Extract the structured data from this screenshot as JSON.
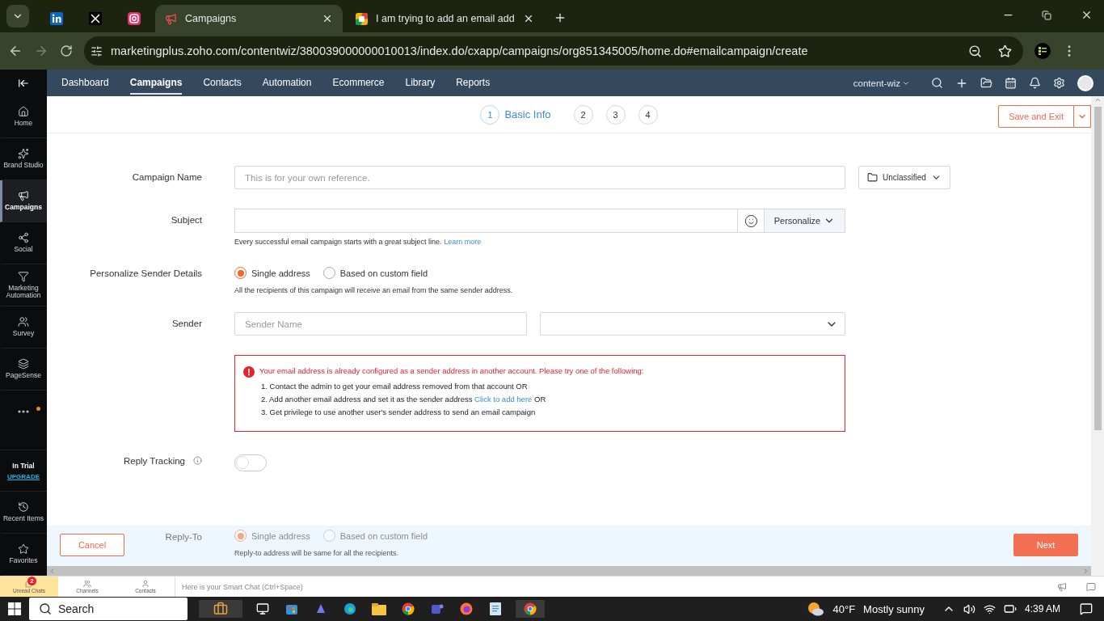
{
  "browser": {
    "tabs": [
      {
        "kind": "linkedin",
        "selected": false
      },
      {
        "kind": "x",
        "selected": false
      },
      {
        "kind": "instagram",
        "selected": false
      },
      {
        "kind": "page",
        "title": "Campaigns",
        "selected": true
      },
      {
        "kind": "page",
        "title": "I am trying to add an email add",
        "selected": false
      }
    ],
    "url": "marketingplus.zoho.com/contentwiz/380039000000010013/index.do/cxapp/campaigns/org851345005/home.do#emailcampaign/create"
  },
  "top_nav": {
    "items": [
      {
        "label": "Dashboard",
        "selected": false
      },
      {
        "label": "Campaigns",
        "selected": true
      },
      {
        "label": "Contacts",
        "selected": false
      },
      {
        "label": "Automation",
        "selected": false
      },
      {
        "label": "Ecommerce",
        "selected": false
      },
      {
        "label": "Library",
        "selected": false
      },
      {
        "label": "Reports",
        "selected": false
      }
    ],
    "account": "content-wiz"
  },
  "sidebar": {
    "items": [
      {
        "kind": "home",
        "label": "Home",
        "selected": false
      },
      {
        "kind": "brand",
        "label": "Brand Studio",
        "selected": false
      },
      {
        "kind": "campaigns",
        "label": "Campaigns",
        "selected": true
      },
      {
        "kind": "social",
        "label": "Social",
        "selected": false
      },
      {
        "kind": "automation",
        "label": "Marketing Automation",
        "selected": false
      },
      {
        "kind": "survey",
        "label": "Survey",
        "selected": false
      },
      {
        "kind": "pagesense",
        "label": "PageSense",
        "selected": false
      }
    ],
    "more_has_notification": true,
    "trial": {
      "status": "In Trial",
      "link": "UPGRADE"
    },
    "bottom_items": [
      {
        "kind": "recent",
        "label": "Recent Items"
      },
      {
        "kind": "favorites",
        "label": "Favorites"
      }
    ]
  },
  "steps": [
    {
      "number": "1",
      "label": "Basic Info",
      "selected": true
    },
    {
      "number": "2",
      "selected": false
    },
    {
      "number": "3",
      "selected": false
    },
    {
      "number": "4",
      "selected": false
    }
  ],
  "save_button": "Save and Exit",
  "form": {
    "campaign_name": {
      "label": "Campaign Name",
      "placeholder": "This is for your own reference.",
      "folder": "Unclassified"
    },
    "subject": {
      "label": "Subject",
      "personalize": "Personalize",
      "hint": "Every successful email campaign starts with a great subject line.",
      "hint_link": "Learn more"
    },
    "sender_details": {
      "label": "Personalize Sender Details",
      "options": [
        {
          "label": "Single address",
          "selected": true
        },
        {
          "label": "Based on custom field",
          "selected": false
        }
      ],
      "hint": "All the recipients of this campaign will receive an email from the same sender address."
    },
    "sender": {
      "label": "Sender",
      "placeholder": "Sender Name"
    },
    "error": {
      "title": "Your email address is already configured as a sender address in another account. Please try one of the following:",
      "items": [
        {
          "text": "1. Contact the admin to get your email address removed from that account OR"
        },
        {
          "text": "2. Add another email address and set it as the sender address",
          "link": "Click to add here",
          "suffix": "OR"
        },
        {
          "text": "3. Get privilege to use another user's sender address to send an email campaign"
        }
      ]
    },
    "reply_tracking": {
      "label": "Reply Tracking",
      "on": false
    },
    "reply_to": {
      "label": "Reply-To",
      "disabled": true,
      "options": [
        {
          "label": "Single address",
          "selected": true
        },
        {
          "label": "Based on custom field",
          "selected": false
        }
      ],
      "hint": "Reply-to address will be same for all the recipients."
    }
  },
  "footer": {
    "cancel": "Cancel",
    "next": "Next"
  },
  "chat_bar": {
    "tabs": [
      {
        "kind": "chats",
        "label": "Unread Chats",
        "badge": "2",
        "selected": true
      },
      {
        "kind": "channels",
        "label": "Channels",
        "selected": false
      },
      {
        "kind": "contacts",
        "label": "Contacts",
        "selected": false
      }
    ],
    "placeholder": "Here is your Smart Chat (Ctrl+Space)"
  },
  "taskbar": {
    "search": "Search",
    "temperature": "40°F",
    "weather": "Mostly sunny",
    "time": "4:39 AM"
  }
}
